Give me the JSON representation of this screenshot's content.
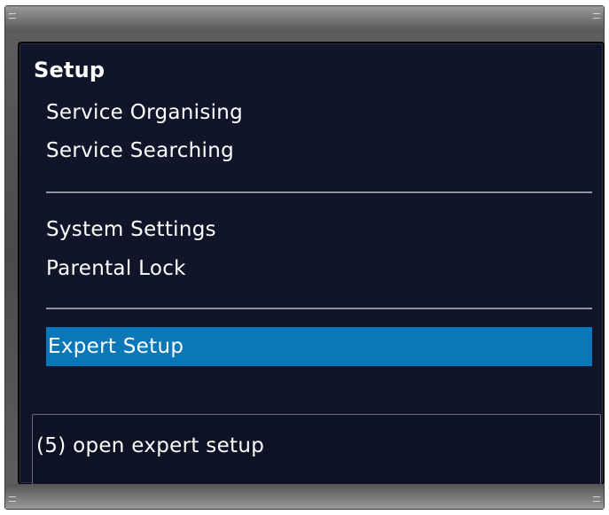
{
  "menu": {
    "title": "Setup",
    "groups": [
      {
        "items": [
          {
            "label": "Service Organising"
          },
          {
            "label": "Service Searching"
          }
        ]
      },
      {
        "items": [
          {
            "label": "System Settings"
          },
          {
            "label": "Parental Lock"
          }
        ]
      },
      {
        "items": [
          {
            "label": "Expert Setup",
            "selected": true
          }
        ]
      }
    ]
  },
  "status": {
    "help_text": "(5) open expert setup"
  },
  "colors": {
    "background": "#11152a",
    "highlight": "#0a78b8",
    "text": "#ffffff",
    "divider": "#8f939c"
  }
}
